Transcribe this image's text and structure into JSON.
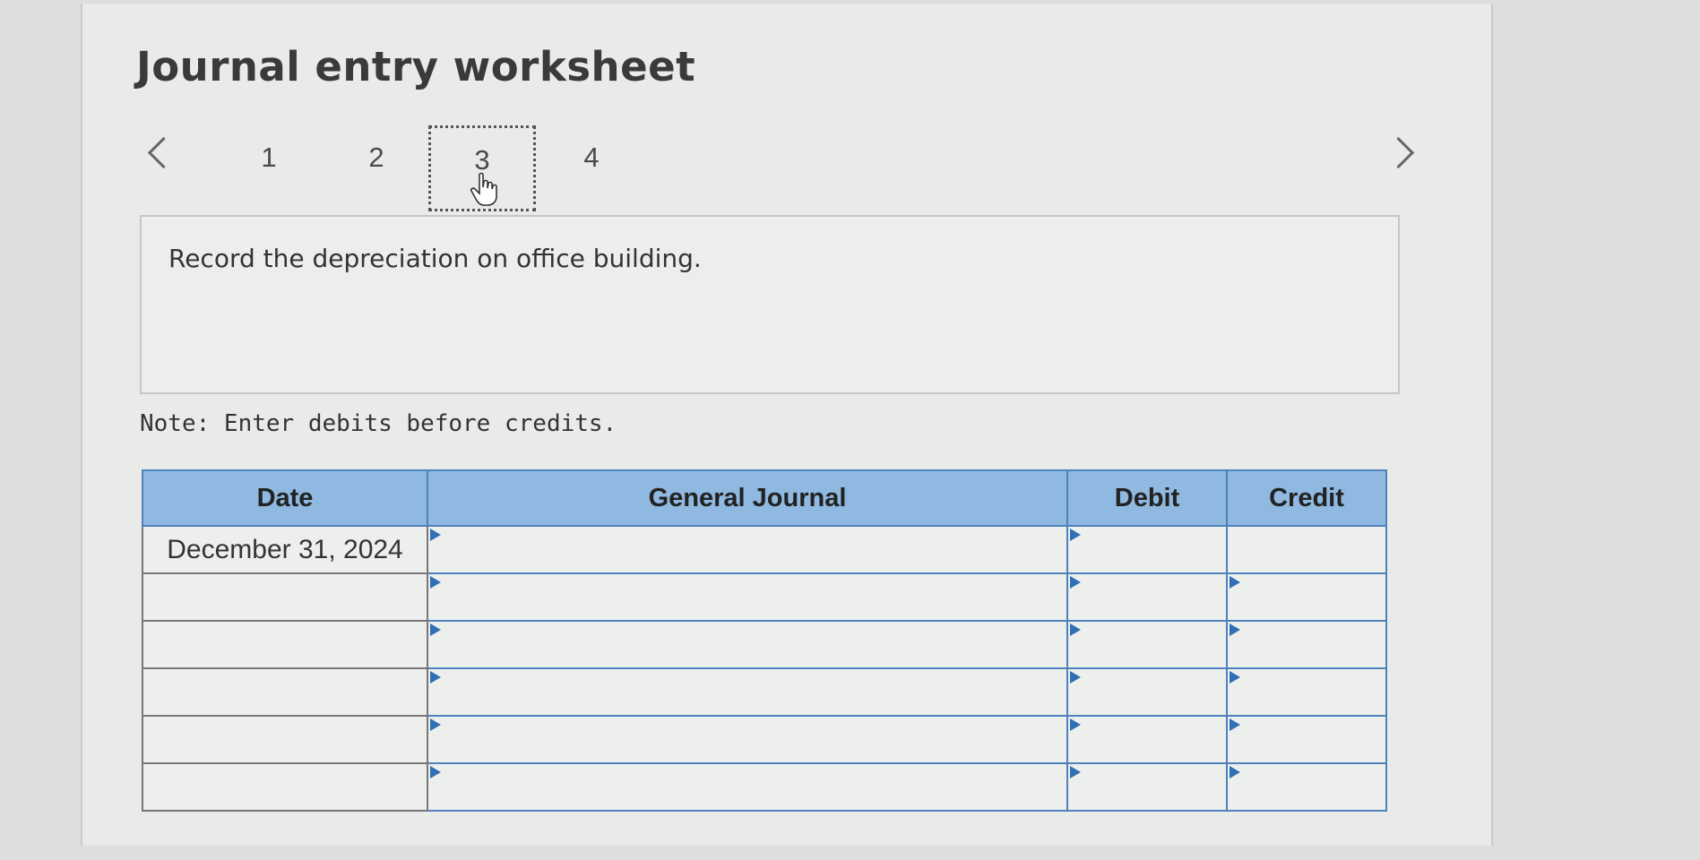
{
  "title": "Journal entry worksheet",
  "navigation": {
    "tabs": [
      {
        "label": "1",
        "active": false
      },
      {
        "label": "2",
        "active": false
      },
      {
        "label": "3",
        "active": true
      },
      {
        "label": "4",
        "active": false
      }
    ]
  },
  "prompt": "Record the depreciation on office building.",
  "note": "Note: Enter debits before credits.",
  "journal_table": {
    "headers": {
      "date": "Date",
      "general_journal": "General Journal",
      "debit": "Debit",
      "credit": "Credit"
    },
    "rows": [
      {
        "date": "December 31, 2024",
        "account": "",
        "debit": "",
        "credit": ""
      },
      {
        "date": "",
        "account": "",
        "debit": "",
        "credit": ""
      },
      {
        "date": "",
        "account": "",
        "debit": "",
        "credit": ""
      },
      {
        "date": "",
        "account": "",
        "debit": "",
        "credit": ""
      },
      {
        "date": "",
        "account": "",
        "debit": "",
        "credit": ""
      },
      {
        "date": "",
        "account": "",
        "debit": "",
        "credit": ""
      }
    ]
  },
  "colors": {
    "header_bg": "#8fb9e0",
    "cell_border": "#4f81bd"
  }
}
